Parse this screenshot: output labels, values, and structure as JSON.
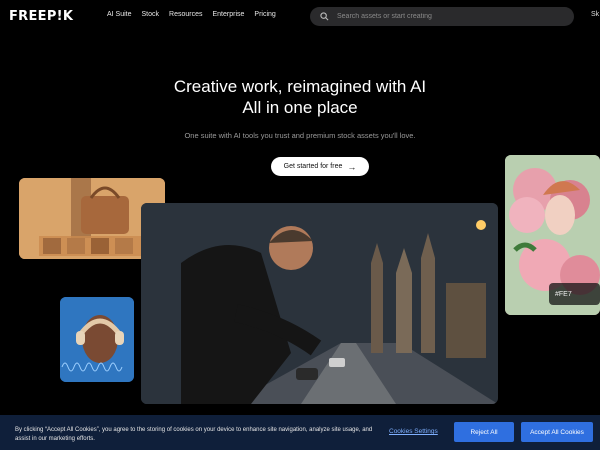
{
  "brand": {
    "logo_text": "FREEP!K"
  },
  "nav": {
    "links": [
      "AI Suite",
      "Stock",
      "Resources",
      "Enterprise",
      "Pricing"
    ],
    "right_text": "Sk"
  },
  "search": {
    "placeholder": "Search assets or start creating",
    "icon": "search-icon"
  },
  "hero": {
    "title_line1": "Creative work, reimagined with AI",
    "title_line2": "All in one place",
    "subtitle": "One suite with AI tools you trust and premium stock assets you'll love.",
    "cta_label": "Get started for free",
    "cta_arrow": "→"
  },
  "gallery": {
    "color_chip": "#FE7"
  },
  "cookie_banner": {
    "text": "By clicking “Accept All Cookies”, you agree to the storing of cookies on your device to enhance site navigation, analyze site usage, and assist in our marketing efforts.",
    "settings_label": "Cookies Settings",
    "reject_label": "Reject All",
    "accept_label": "Accept All Cookies"
  },
  "colors": {
    "background": "#000000",
    "cookie_bg": "#0f1f3a",
    "button_blue": "#2f6fe0"
  }
}
